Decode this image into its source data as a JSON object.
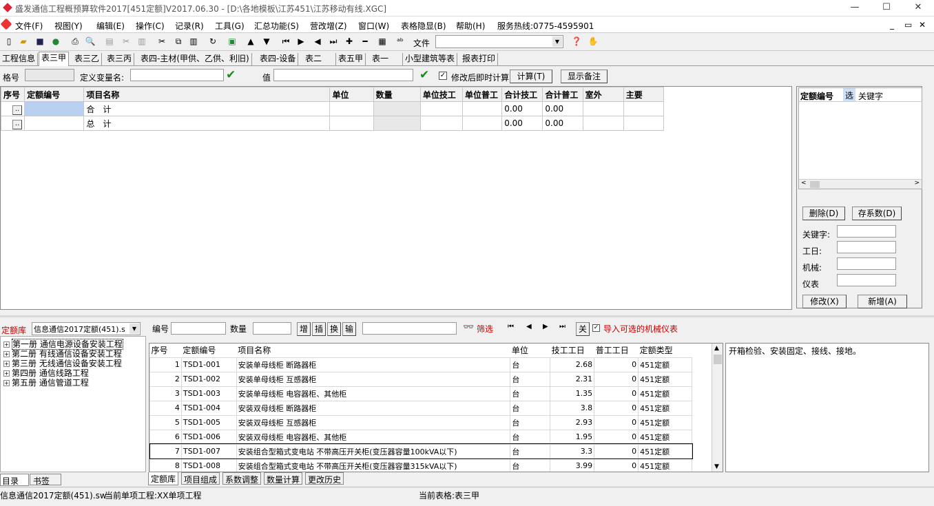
{
  "window": {
    "title": "盛发通信工程概预算软件2017[451定额]V2017.06.30 - [D:\\各地模板\\江苏451\\江苏移动有线.XGC]",
    "min": "—",
    "max": "☐",
    "close": "✕"
  },
  "menu": {
    "items": [
      "文件(F)",
      "视图(Y)",
      "编辑(E)",
      "操作(C)",
      "记录(R)",
      "工具(G)",
      "汇总功能(S)",
      "营改增(Z)",
      "窗口(W)",
      "表格隐显(B)",
      "帮助(H)",
      "服务热线:0775-4595901"
    ],
    "mdi": [
      "_",
      "▭",
      "✕"
    ]
  },
  "toolbar": {
    "file_label": "文件",
    "file_value": ""
  },
  "tabs": [
    "工程信息",
    "表三甲",
    "表三乙",
    "表三丙",
    "表四-主材(甲供、乙供、利旧)",
    "表四-设备",
    "表二",
    "表五甲",
    "表一",
    "小型建筑等表",
    "报表打印"
  ],
  "varbar": {
    "ge_label": "格号",
    "ge_value": "",
    "var_label": "定义变量名:",
    "var_value": "",
    "val_label": "值",
    "val_value": "",
    "recalc_label": "修改后即时计算",
    "calc_button": "计算(T)",
    "note_button": "显示备注"
  },
  "grid1": {
    "headers": [
      "序号",
      "定额编号",
      "项目名称",
      "单位",
      "数量",
      "单位技工",
      "单位普工",
      "合计技工",
      "合计普工",
      "室外",
      "主要"
    ],
    "rows": [
      {
        "btn": "..",
        "name": "合　计",
        "hj_jg": "0.00",
        "hj_pg": "0.00"
      },
      {
        "btn": "..",
        "name": "总　计",
        "hj_jg": "0.00",
        "hj_pg": "0.00"
      }
    ]
  },
  "rightpanel": {
    "headers": [
      "定额编号",
      "选",
      "关键字"
    ],
    "delete_btn": "删除(D)",
    "save_btn": "存系数(D)",
    "keyword_label": "关键字:",
    "workday_label": "工日:",
    "machine_label": "机械:",
    "meter_label": "仪表",
    "modify_btn": "修改(X)",
    "add_btn": "新增(A)"
  },
  "library": {
    "label": "定额库",
    "selected": "信息通信2017定额(451).s",
    "tree": [
      "第一册 通信电源设备安装工程",
      "第二册 有线通信设备安装工程",
      "第三册 无线通信设备安装工程",
      "第四册 通信线路工程",
      "第五册 通信管道工程"
    ],
    "tabs": [
      "目录",
      "书签"
    ]
  },
  "filter": {
    "code_label": "编号",
    "qty_label": "数量",
    "btns": [
      "增",
      "插",
      "换",
      "输"
    ],
    "filter_btn": "筛选",
    "nav": [
      "⏮",
      "◀",
      "▶",
      "⏭"
    ],
    "close_btn": "关",
    "import_label": "导入可选的机械仪表"
  },
  "grid2": {
    "headers": [
      "序号",
      "定额编号",
      "项目名称",
      "单位",
      "技工工日",
      "普工工日",
      "定额类型"
    ],
    "rows": [
      {
        "no": "1",
        "code": "TSD1-001",
        "name": "安装单母线柜 断路器柜",
        "unit": "台",
        "jg": "2.68",
        "pg": "0",
        "type": "451定额"
      },
      {
        "no": "2",
        "code": "TSD1-002",
        "name": "安装单母线柜 互感器柜",
        "unit": "台",
        "jg": "2.31",
        "pg": "0",
        "type": "451定额"
      },
      {
        "no": "3",
        "code": "TSD1-003",
        "name": "安装单母线柜 电容器柜、其他柜",
        "unit": "台",
        "jg": "1.35",
        "pg": "0",
        "type": "451定额"
      },
      {
        "no": "4",
        "code": "TSD1-004",
        "name": "安装双母线柜 断路器柜",
        "unit": "台",
        "jg": "3.8",
        "pg": "0",
        "type": "451定额"
      },
      {
        "no": "5",
        "code": "TSD1-005",
        "name": "安装双母线柜 互感器柜",
        "unit": "台",
        "jg": "2.93",
        "pg": "0",
        "type": "451定额"
      },
      {
        "no": "6",
        "code": "TSD1-006",
        "name": "安装双母线柜 电容器柜、其他柜",
        "unit": "台",
        "jg": "1.95",
        "pg": "0",
        "type": "451定额"
      },
      {
        "no": "7",
        "code": "TSD1-007",
        "name": "安装组合型箱式变电站 不带高压开关柜(变压器容量100kVA以下)",
        "unit": "台",
        "jg": "3.3",
        "pg": "0",
        "type": "451定额"
      },
      {
        "no": "8",
        "code": "TSD1-008",
        "name": "安装组合型箱式变电站 不带高压开关柜(变压器容量315kVA以下)",
        "unit": "台",
        "jg": "3.99",
        "pg": "0",
        "type": "451定额"
      }
    ],
    "tabs": [
      "定额库",
      "项目组成",
      "系数调整",
      "数量计算",
      "更改历史"
    ]
  },
  "description": "开箱检验、安装固定、接线、接地。",
  "status": {
    "library": "信息通信2017定额(451).sw",
    "project": "当前单项工程:XX单项工程",
    "table": "当前表格:表三甲"
  }
}
